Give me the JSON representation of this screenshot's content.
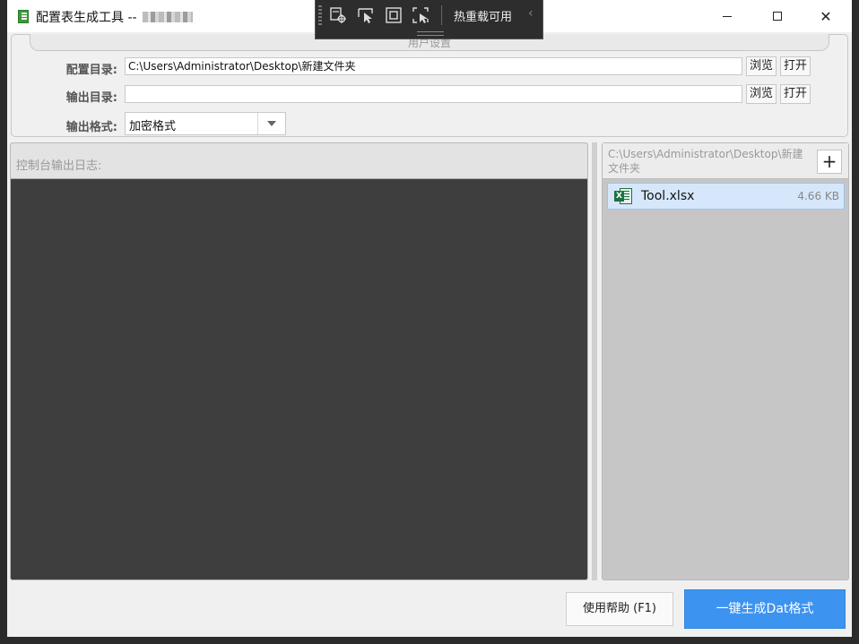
{
  "window": {
    "title": "配置表生成工具 --"
  },
  "dev_toolbar": {
    "label": "热重载可用",
    "icons": [
      "select-element-icon",
      "pointer-icon",
      "layout-adorner-icon",
      "track-focus-icon"
    ]
  },
  "settings": {
    "group_title": "用户设置",
    "config_dir_label": "配置目录:",
    "config_dir_value": "C:\\Users\\Administrator\\Desktop\\新建文件夹",
    "output_dir_label": "输出目录:",
    "output_dir_value": "",
    "output_format_label": "输出格式:",
    "output_format_value": "加密格式",
    "browse_label": "浏览",
    "open_label": "打开"
  },
  "console": {
    "title": "控制台输出日志:"
  },
  "files": {
    "path": "C:\\Users\\Administrator\\Desktop\\新建文件夹",
    "add_label": "+",
    "items": [
      {
        "name": "Tool.xlsx",
        "size": "4.66 KB"
      }
    ]
  },
  "footer": {
    "help_label": "使用帮助 (F1)",
    "generate_label": "一键生成Dat格式"
  },
  "colors": {
    "accent": "#3d93f0",
    "console_bg": "#3e3e3e",
    "selection": "#d6e7fb"
  }
}
